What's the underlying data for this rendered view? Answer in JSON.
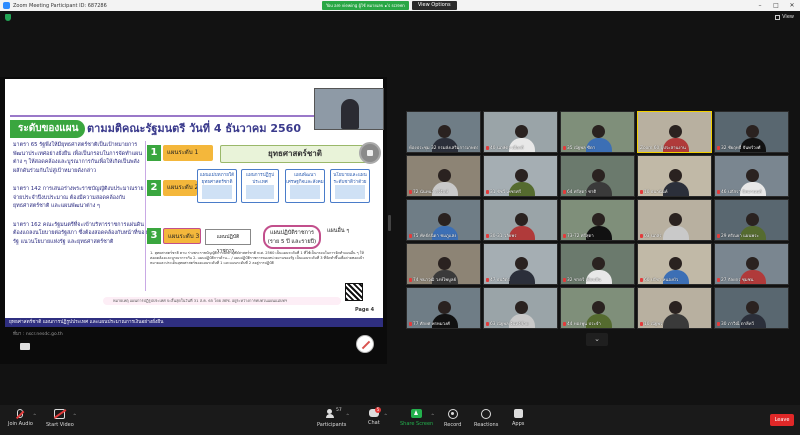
{
  "window": {
    "title": "Zoom Meeting Participant ID: 687286",
    "share_status": "You are viewing ผู้ใช้ หมายเลข ๑'s screen",
    "view_options": "View Options",
    "controls": [
      "–",
      "□",
      "✕"
    ]
  },
  "top": {
    "view_label": "View"
  },
  "slide": {
    "badge": "ระดับของแผน",
    "title": "ตามมติคณะรัฐมนตรี วันที่ 4 ธันวาคม 2560",
    "left_paragraphs": [
      "มาตรา 65 รัฐพึงให้มียุทธศาสตร์ชาติเป็นเป้าหมายการพัฒนาประเทศอย่างยั่งยืน เพื่อเป็นกรอบในการจัดทำแผนต่าง ๆ ให้สอดคล้องและบูรณาการกันเพื่อให้เกิดเป็นพลังผลักดันร่วมกันไปสู่เป้าหมายดังกล่าว",
      "มาตรา 142 การเสนอร่างพระราชบัญญัติงบประมาณรายจ่ายประจำปีงบประมาณ ต้องมีความสอดคล้องกับยุทธศาสตร์ชาติ และแผนพัฒนาต่าง ๆ",
      "มาตรา 162 คณะรัฐมนตรีที่จะเข้าบริหารราชการแผ่นดินต้องแถลงนโยบายต่อรัฐสภา ซึ่งต้องสอดคล้องกับหน้าที่ของรัฐ แนวนโยบายแห่งรัฐ และยุทธศาสตร์ชาติ"
    ],
    "levels": [
      {
        "num": "1",
        "label": "แผนระดับ 1"
      },
      {
        "num": "2",
        "label": "แผนระดับ 2"
      },
      {
        "num": "3",
        "label": "แผนระดับ 3"
      }
    ],
    "strategy_label": "ยุทธศาสตร์ชาติ",
    "plan_boxes": [
      "แผนแม่บทภายใต้ยุทธศาสตร์ชาติ",
      "แผนการปฏิรูปประเทศ",
      "แผนพัฒนาเศรษฐกิจและสังคมแห่งชาติ",
      "นโยบายและแผนระดับชาติว่าด้วยความมั่นคง"
    ],
    "plan_mid": "แผนปฏิบัติราชการ...",
    "plan_gov": "แผนปฏิบัติราชการ (ราย 5 ปี และรายปี)",
    "plan_other": "แผนอื่น ๆ",
    "notes": "1. ยุทธศาสตร์ชาติ ตาม ร่างพระราชบัญญัติการจัดทำยุทธศาสตร์ชาติ พ.ศ. 2560 เป็นแผนระดับที่ 1 ที่ใช้เป็นกรอบในการจัดทำแผนอื่น ๆ ให้สอดคล้องและบูรณาการกัน 2. แผนปฏิบัติการด้าน... / แผนปฏิบัติราชการของหน่วยงานของรัฐ เป็นแผนระดับที่ 3 ที่จัดทำขึ้นเพื่อถ่ายทอดเป้าหมายและประเด็นยุทธศาสตร์ของแผนระดับที่ 1 และแผนระดับที่ 2 ลงสู่การปฏิบัติ",
    "notes_bar": "หมายเหตุ แผนการปฏิรูปประเทศ จะสิ้นสุดในวันที่ 31 ส.ค. 65 โดย สศช. อยู่ระหว่างการทบทวนแผนแม่บทฯ",
    "footer": "ยุทธศาสตร์ชาติ แผนการปฏิรูปประเทศ และแผนประมาณการเงินอย่างยั่งยืน",
    "page": "Page 4",
    "link": "ที่มา : nscr.nesdc.go.th"
  },
  "participants": [
    {
      "name": "ห้องประชุม 32 กรมส่งเสริมการเกษตร",
      "muted": false
    },
    {
      "name": "40 นภษัตร เมืองดี",
      "muted": true
    },
    {
      "name": "35 ณัฐพล ซิดา",
      "muted": true
    },
    {
      "name": "Zoom 60 ผู้ประสานงาน",
      "muted": false
    },
    {
      "name": "32 ชัยฤทธิ์ จันทร์วงศ์",
      "muted": true
    },
    {
      "name": "72 นันทนา ศรีรักษ์",
      "muted": true
    },
    {
      "name": "31 ชัชวี เพชรศรี",
      "muted": true
    },
    {
      "name": "64 ศรีสุดา ชาติ",
      "muted": true
    },
    {
      "name": "10 ธนานันท์",
      "muted": true
    },
    {
      "name": "46 ปภัสรา ปัทมานนท์",
      "muted": true
    },
    {
      "name": "75 พัทธ์ธนิดา ชมภูแสง",
      "muted": true
    },
    {
      "name": "30-31 วลัยพร",
      "muted": true
    },
    {
      "name": "73-72 ศรีสุดา",
      "muted": true
    },
    {
      "name": "03 นภสร",
      "muted": true
    },
    {
      "name": "29 ศรัณยา แผนพระ",
      "muted": true
    },
    {
      "name": "74 ชนาวุฒิ วงษ์ไพบูลย์",
      "muted": true
    },
    {
      "name": "47 ธนวัตร",
      "muted": true
    },
    {
      "name": "32 ชาตรี เทียนปัน",
      "muted": true
    },
    {
      "name": "60 ปรีชา หนองบัว",
      "muted": true
    },
    {
      "name": "27 กัลยกร ชุมชน",
      "muted": true
    },
    {
      "name": "77 ศักยศ พรหมวงศ์",
      "muted": true
    },
    {
      "name": "63 ณัฐพล จันทร์ซ้าย",
      "muted": true
    },
    {
      "name": "44 ทองพูน ประจำ",
      "muted": true
    },
    {
      "name": "10 ณัฐพร",
      "muted": true
    },
    {
      "name": "30 ภาวิณี ตาลีทวี",
      "muted": true
    }
  ],
  "toolbar": {
    "join_audio": "Join Audio",
    "start_video": "Start Video",
    "participants": "Participants",
    "participants_count": "57",
    "chat": "Chat",
    "chat_badge": "5",
    "share_screen": "Share Screen",
    "record": "Record",
    "reactions": "Reactions",
    "apps": "Apps",
    "leave": "Leave"
  },
  "colors": {
    "share_green": "#23b14d",
    "leave_red": "#e02828",
    "active_speaker": "#f3d000",
    "slide_green": "#3aa63f",
    "slide_navy": "#2f2f80"
  }
}
